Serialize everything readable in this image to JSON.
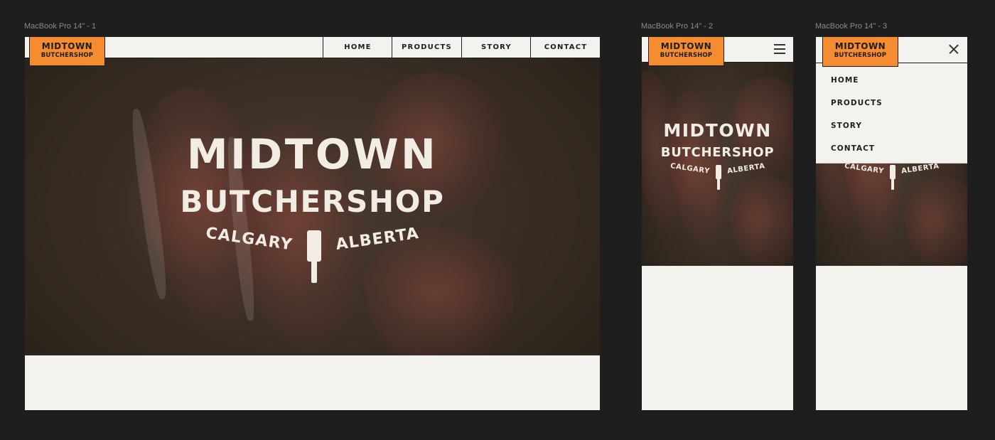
{
  "frames": [
    {
      "label": "MacBook Pro 14\" - 1"
    },
    {
      "label": "MacBook Pro 14\" - 2"
    },
    {
      "label": "MacBook Pro 14\" - 3"
    }
  ],
  "brand": {
    "logo_line1": "MIDTOWN",
    "logo_line2": "BUTCHERSHOP",
    "accent_color": "#f58c30"
  },
  "nav": [
    {
      "label": "HOME"
    },
    {
      "label": "PRODUCTS"
    },
    {
      "label": "STORY"
    },
    {
      "label": "CONTACT"
    }
  ],
  "hero": {
    "title_line1": "MIDTOWN",
    "title_line2": "BUTCHERSHOP",
    "city": "CALGARY",
    "province": "ALBERTA",
    "icon": "cleaver-icon"
  },
  "icons": {
    "menu": "hamburger-icon",
    "close": "close-icon"
  }
}
